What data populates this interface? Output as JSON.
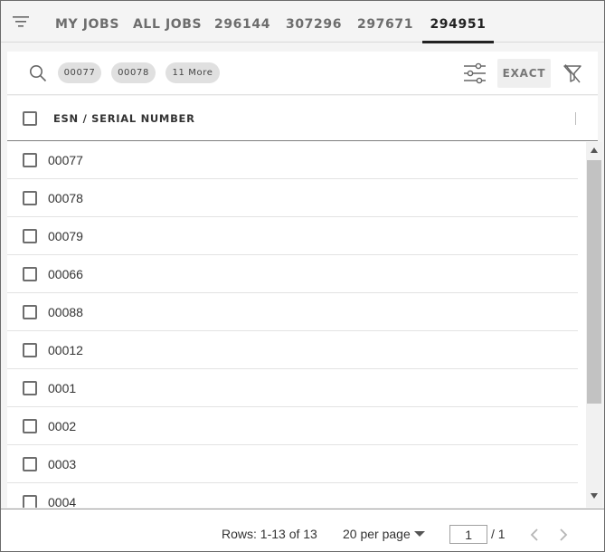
{
  "tabs": [
    {
      "label": "MY JOBS",
      "active": false
    },
    {
      "label": "ALL JOBS",
      "active": false
    },
    {
      "label": "296144",
      "active": false
    },
    {
      "label": "307296",
      "active": false
    },
    {
      "label": "297671",
      "active": false
    },
    {
      "label": "294951",
      "active": true
    }
  ],
  "filter": {
    "search_icon": "search-icon",
    "chips": [
      "00077",
      "00078",
      "11 More"
    ],
    "tune_icon": "sliders-icon",
    "exact_label": "EXACT",
    "funnel_icon": "filter-off-icon"
  },
  "table": {
    "column_header": "ESN / SERIAL NUMBER",
    "rows": [
      "00077",
      "00078",
      "00079",
      "00066",
      "00088",
      "00012",
      "0001",
      "0002",
      "0003",
      "0004"
    ]
  },
  "footer": {
    "rows_info": "Rows: 1-13 of 13",
    "per_page": "20 per page",
    "page_value": "1",
    "page_total": "/ 1"
  },
  "colors": {
    "active_tab": "#222222",
    "inactive_tab": "#6d6d6d",
    "chip_bg": "#e0e0e0",
    "scroll_thumb": "#c2c2c2"
  }
}
